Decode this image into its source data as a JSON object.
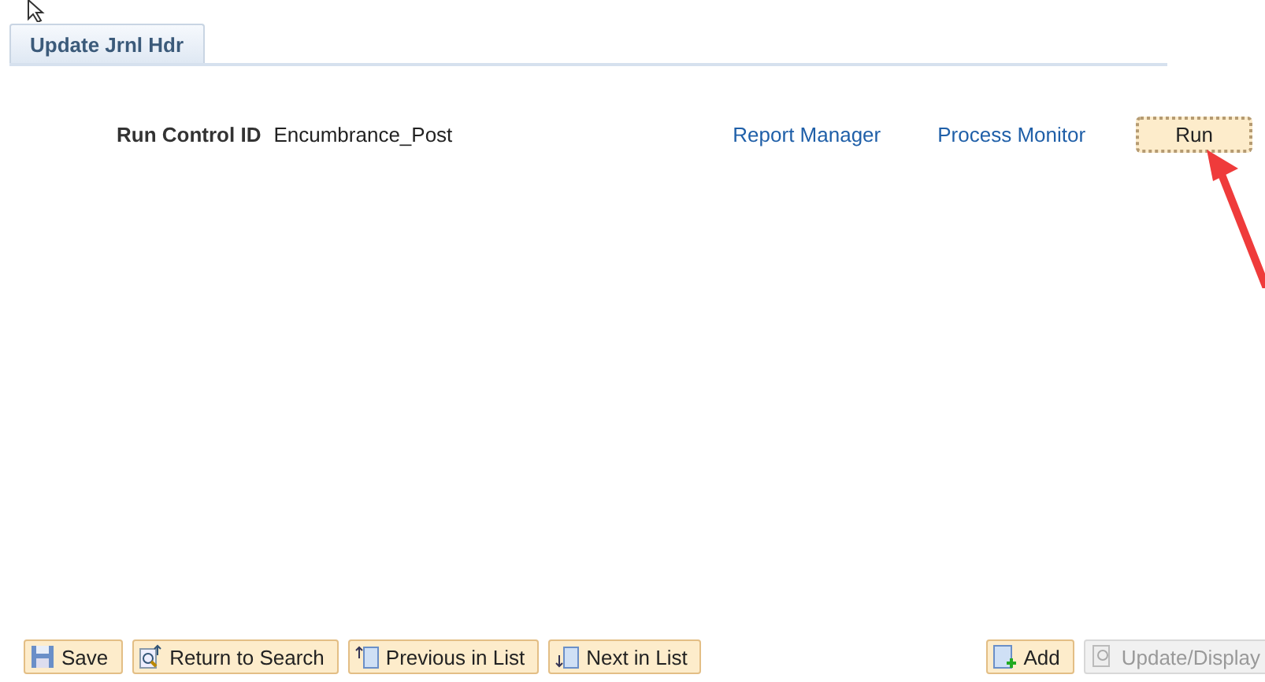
{
  "tabs": [
    {
      "label": "Update Jrnl Hdr",
      "selected": true
    }
  ],
  "run_control": {
    "label": "Run Control ID",
    "value": "Encumbrance_Post"
  },
  "links": [
    "Report Manager",
    "Process Monitor"
  ],
  "run_button": {
    "label": "Run"
  },
  "toolbar_left": [
    {
      "label": "Save",
      "kind": "save",
      "disabled": false
    },
    {
      "label": "Return to Search",
      "kind": "search",
      "disabled": false
    },
    {
      "label": "Previous in List",
      "kind": "previous",
      "disabled": false
    },
    {
      "label": "Next in List",
      "kind": "next",
      "disabled": false
    }
  ],
  "toolbar_right": [
    {
      "label": "Add",
      "kind": "add",
      "disabled": false
    },
    {
      "label": "Update/Display",
      "kind": "update",
      "disabled": true
    }
  ]
}
